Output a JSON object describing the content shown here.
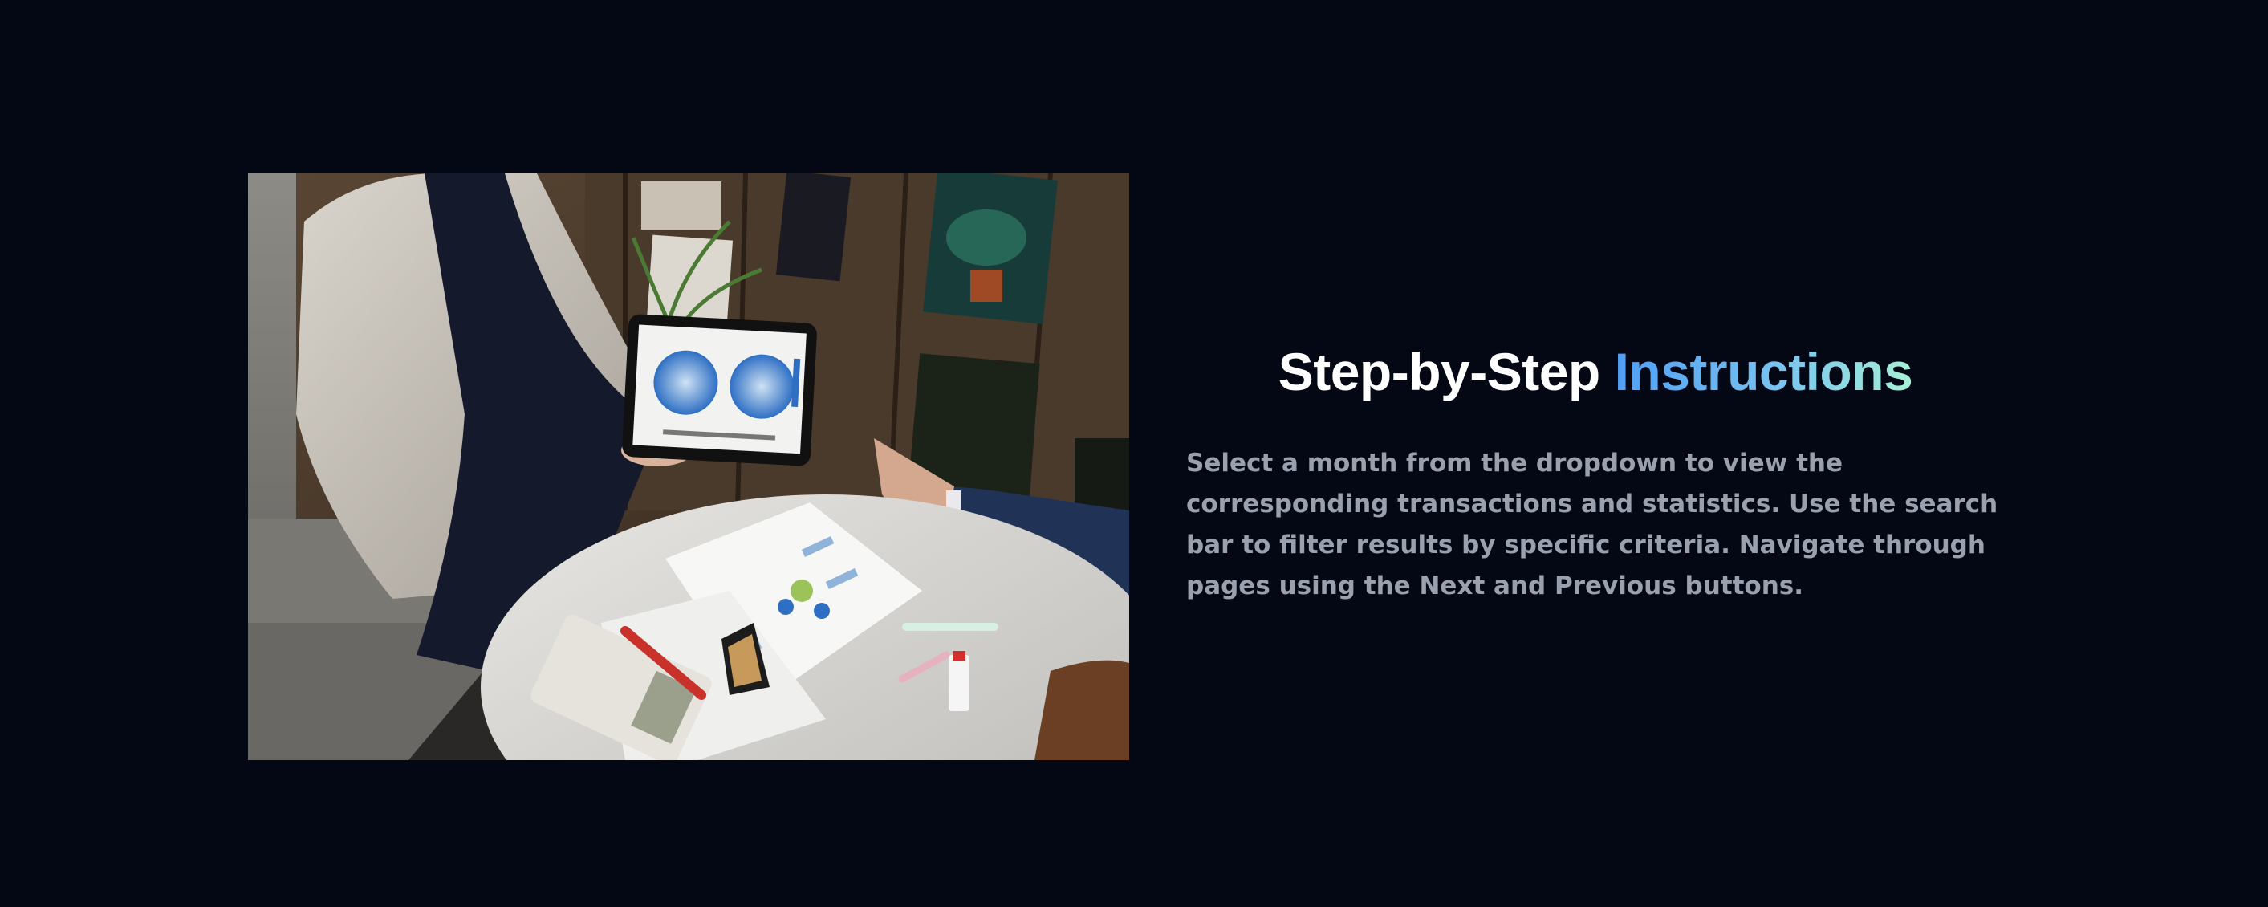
{
  "section": {
    "title_main": "Step-by-Step ",
    "title_accent": "Instructions",
    "description": "Select a month from the dropdown to view the corresponding transactions and statistics. Use the search bar to filter results by specific criteria. Navigate through pages using the Next and Previous buttons."
  },
  "colors": {
    "background": "#030814",
    "title": "#ffffff",
    "accent_start": "#4f9ff5",
    "accent_end": "#a8f0d6",
    "description": "#9aa0ad"
  },
  "image": {
    "icon": "meeting-photo"
  }
}
